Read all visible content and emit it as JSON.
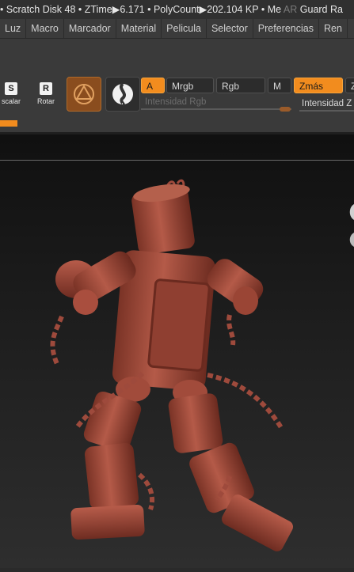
{
  "status": {
    "dot": "•",
    "scratch_disk": "Scratch Disk 48",
    "ztime": "ZTime▶6.171",
    "polycount": "PolyCount▶202.104 KP",
    "me": "Me",
    "ar": "AR",
    "guard": "Guard Ra"
  },
  "menu": [
    "Luz",
    "Macro",
    "Marcador",
    "Material",
    "Pelicula",
    "Selector",
    "Preferencias",
    "Ren"
  ],
  "tools": {
    "escalar": {
      "letter": "S",
      "label": "scalar"
    },
    "rotar": {
      "letter": "R",
      "label": "Rotar"
    }
  },
  "channels": {
    "a": "A",
    "mrgb": "Mrgb",
    "rgb": "Rgb",
    "m": "M",
    "zmas": "Zmás",
    "z": "Z"
  },
  "sliders": {
    "rgb_intensity": "Intensidad Rgb",
    "z_intensity": "Intensidad Z"
  },
  "colors": {
    "accent": "#f28c1e",
    "model": "#9e4a3c"
  }
}
